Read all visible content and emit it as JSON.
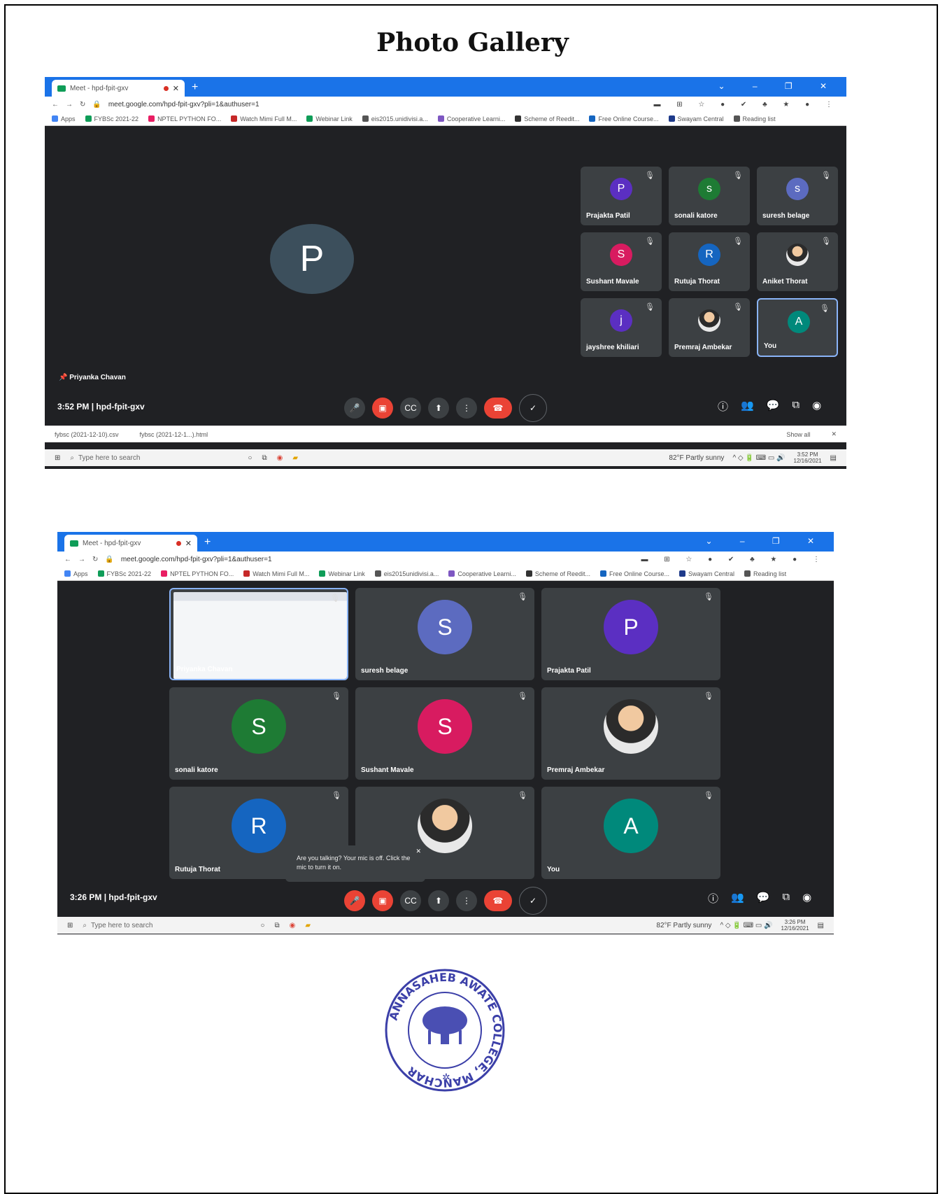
{
  "page": {
    "title": "Photo Gallery"
  },
  "screenshot1": {
    "tab_title": "Meet - hpd-fpit-gxv",
    "url": "meet.google.com/hpd-fpit-gxv?pli=1&authuser=1",
    "bookmarks": [
      "Apps",
      "FYBSc 2021-22",
      "NPTEL PYTHON FO...",
      "Watch Mimi Full M...",
      "Webinar Link",
      "eis2015.unidivisi.a...",
      "Cooperative Learni...",
      "Scheme of Reedit...",
      "Free Online Course...",
      "Swayam Central",
      "Reading list"
    ],
    "spotlight": {
      "initial": "P",
      "name": "Priyanka Chavan",
      "color": "#3c4f5c"
    },
    "tiles": [
      {
        "initial": "P",
        "name": "Prajakta Patil",
        "color": "#5b2fc2"
      },
      {
        "initial": "s",
        "name": "sonali katore",
        "color": "#1e7b34"
      },
      {
        "initial": "s",
        "name": "suresh belage",
        "color": "#5c6bc0"
      },
      {
        "initial": "S",
        "name": "Sushant Mavale",
        "color": "#d81b60"
      },
      {
        "initial": "R",
        "name": "Rutuja Thorat",
        "color": "#1565c0"
      },
      {
        "initial": "",
        "name": "Aniket Thorat",
        "color": ""
      },
      {
        "initial": "j",
        "name": "jayshree khiliari",
        "color": "#5b2fc2"
      },
      {
        "initial": "",
        "name": "Premraj Ambekar",
        "color": ""
      },
      {
        "initial": "A",
        "name": "You",
        "color": "#00897b"
      }
    ],
    "meeting_time": "3:52 PM",
    "meeting_code": "hpd-fpit-gxv",
    "downloads": [
      "fybsc (2021-12-10).csv",
      "fybsc (2021-12-1...).html"
    ],
    "show_all": "Show all",
    "search_placeholder": "Type here to search",
    "weather": "82°F Partly sunny",
    "clock_time": "3:52 PM",
    "clock_date": "12/16/2021"
  },
  "screenshot2": {
    "tab_title": "Meet - hpd-fpit-gxv",
    "url": "meet.google.com/hpd-fpit-gxv?pli=1&authuser=1",
    "bookmarks": [
      "Apps",
      "FYBSc 2021-22",
      "NPTEL PYTHON FO...",
      "Watch Mimi Full M...",
      "Webinar Link",
      "eis2015unidivisi.a...",
      "Cooperative Learni...",
      "Scheme of Reedit...",
      "Free Online Course...",
      "Swayam Central",
      "Reading list"
    ],
    "tiles": [
      {
        "initial": "",
        "name": "Priyanka Chavan",
        "color": ""
      },
      {
        "initial": "S",
        "name": "suresh belage",
        "color": "#5c6bc0"
      },
      {
        "initial": "P",
        "name": "Prajakta Patil",
        "color": "#5b2fc2"
      },
      {
        "initial": "S",
        "name": "sonali katore",
        "color": "#1e7b34"
      },
      {
        "initial": "S",
        "name": "Sushant Mavale",
        "color": "#d81b60"
      },
      {
        "initial": "",
        "name": "Premraj Ambekar",
        "color": ""
      },
      {
        "initial": "R",
        "name": "Rutuja Thorat",
        "color": "#1565c0"
      },
      {
        "initial": "",
        "name": "",
        "color": ""
      },
      {
        "initial": "A",
        "name": "You",
        "color": "#00897b"
      }
    ],
    "toast": "Are you talking? Your mic is off. Click the mic to turn it on.",
    "meeting_time": "3:26 PM",
    "meeting_code": "hpd-fpit-gxv",
    "search_placeholder": "Type here to search",
    "weather": "82°F Partly sunny",
    "clock_time": "3:26 PM",
    "clock_date": "12/16/2021"
  },
  "stamp": {
    "text": "ANNASAHEB AWATE COLLEGE, MANCHAR"
  }
}
